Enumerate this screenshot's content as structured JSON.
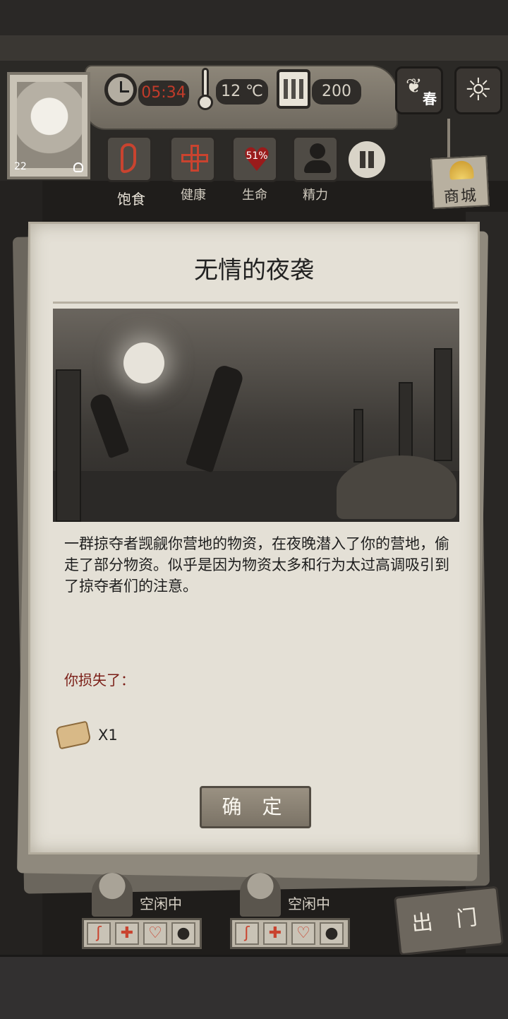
{
  "header": {
    "character_age": "22",
    "time": "05:34",
    "temperature": "12 ℃",
    "day": "200",
    "season": "春",
    "status_labels": [
      "饱食",
      "健康",
      "生命",
      "精力"
    ],
    "health_percent": "51%",
    "shop_label": "商城",
    "accent_time_color": "#c23b2a"
  },
  "dialog": {
    "title": "无情的夜袭",
    "body": "一群掠夺者觊觎你营地的物资，在夜晚潜入了你的营地，偷走了部分物资。似乎是因为物资太多和行为太过高调吸引到了掠夺者们的注意。",
    "loss_label": "你损失了：",
    "loss_item_icon": "scroll-icon",
    "loss_item_qty": "X1",
    "confirm_label": "确 定"
  },
  "companions": [
    {
      "status": "空闲中"
    },
    {
      "status": "空闲中"
    }
  ],
  "exit_label": "出 门"
}
